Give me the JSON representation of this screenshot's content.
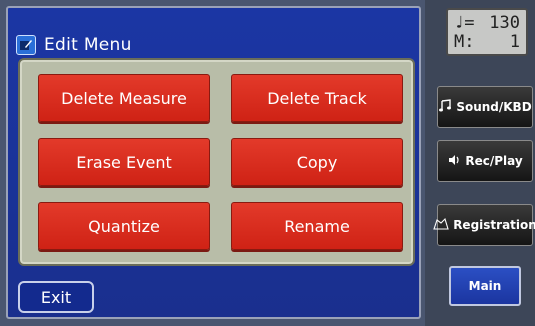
{
  "header": {
    "title": "Edit Menu",
    "icon": "edit-icon"
  },
  "menu": {
    "delete_measure": "Delete Measure",
    "delete_track": "Delete Track",
    "erase_event": "Erase Event",
    "copy": "Copy",
    "quantize": "Quantize",
    "rename": "Rename"
  },
  "footer": {
    "exit_label": "Exit"
  },
  "status": {
    "tempo_note": "♩=",
    "tempo_value": "130",
    "measure_label": "M:",
    "measure_value": "1"
  },
  "sidebar": {
    "sound_kbd": {
      "label": "Sound/KBD",
      "icon": "music-notes-icon"
    },
    "rec_play": {
      "label": "Rec/Play",
      "icon": "speaker-icon"
    },
    "registration": {
      "label": "Registration",
      "icon": "registration-icon"
    },
    "main": {
      "label": "Main"
    }
  },
  "colors": {
    "screen_bg": "#1b36a4",
    "button_red": "#d9281a",
    "panel": "#b8bda8"
  }
}
